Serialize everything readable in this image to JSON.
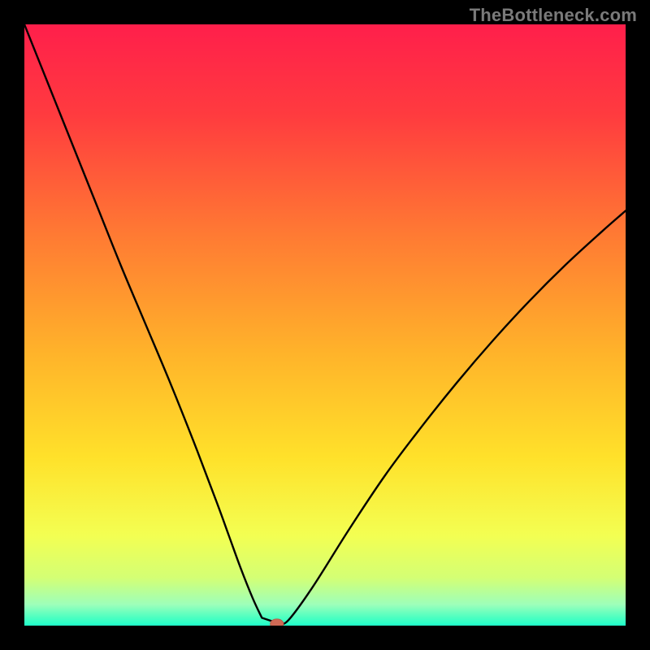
{
  "watermark": {
    "text": "TheBottleneck.com"
  },
  "colors": {
    "page_bg": "#000000",
    "curve": "#000000",
    "marker_fill": "#cf6a56",
    "marker_stroke": "#b85a48",
    "gradient_stops": [
      {
        "offset": 0.0,
        "color": "#ff1f4b"
      },
      {
        "offset": 0.15,
        "color": "#ff3b3f"
      },
      {
        "offset": 0.35,
        "color": "#ff7a33"
      },
      {
        "offset": 0.55,
        "color": "#ffb42a"
      },
      {
        "offset": 0.72,
        "color": "#ffe12a"
      },
      {
        "offset": 0.85,
        "color": "#f3ff52"
      },
      {
        "offset": 0.92,
        "color": "#d4ff74"
      },
      {
        "offset": 0.965,
        "color": "#9dffba"
      },
      {
        "offset": 0.985,
        "color": "#52ffc0"
      },
      {
        "offset": 1.0,
        "color": "#1fffc9"
      }
    ]
  },
  "chart_data": {
    "type": "line",
    "title": "",
    "xlabel": "",
    "ylabel": "",
    "xlim": [
      0,
      100
    ],
    "ylim": [
      0,
      100
    ],
    "grid": false,
    "legend": false,
    "series": [
      {
        "name": "bottleneck-curve",
        "x": [
          0,
          4,
          8,
          12,
          16,
          20,
          24,
          28,
          32,
          34,
          36,
          38,
          39.5,
          41,
          42.5,
          44,
          48,
          54,
          60,
          66,
          72,
          78,
          84,
          90,
          96,
          100
        ],
        "y": [
          100,
          90,
          80,
          70,
          60,
          50.5,
          41,
          31,
          20.5,
          15,
          9.5,
          4.5,
          1.3,
          0.3,
          0.3,
          1.0,
          6.5,
          16,
          25,
          33,
          40.5,
          47.5,
          54,
          60,
          65.5,
          69
        ]
      }
    ],
    "marker": {
      "x": 42,
      "y": 0.3,
      "rx": 1.1,
      "ry": 0.8
    },
    "flat_notch": {
      "x0": 39.5,
      "x1": 42.5,
      "y": 0.3
    }
  }
}
